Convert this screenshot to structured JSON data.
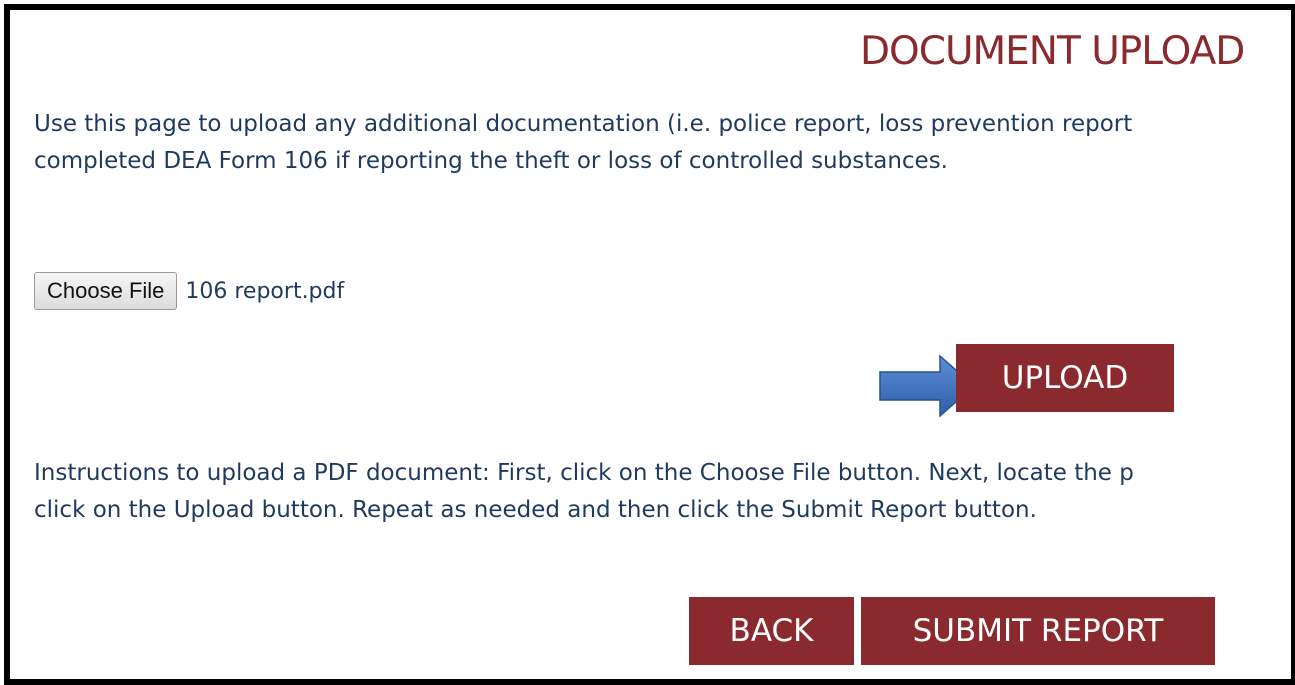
{
  "page": {
    "title": "DOCUMENT UPLOAD",
    "intro_line1": "Use this page to upload any additional documentation (i.e. police report, loss prevention report",
    "intro_line2": "completed DEA Form 106 if reporting the theft or loss of controlled substances.",
    "instructions_line1": "Instructions to upload a PDF document: First, click on the Choose File button. Next, locate the p",
    "instructions_line2": "click on the Upload button. Repeat as needed and then click the Submit Report button."
  },
  "file_input": {
    "button_label": "Choose File",
    "selected_file": "106 report.pdf"
  },
  "actions": {
    "upload_label": "UPLOAD",
    "back_label": "BACK",
    "submit_label": "SUBMIT REPORT"
  },
  "icons": {
    "pointer": "arrow-right-icon"
  },
  "colors": {
    "brand_red": "#8b2a2e",
    "body_text": "#1f3a5f",
    "arrow_blue": "#3f72c0",
    "frame_border": "#000000"
  }
}
